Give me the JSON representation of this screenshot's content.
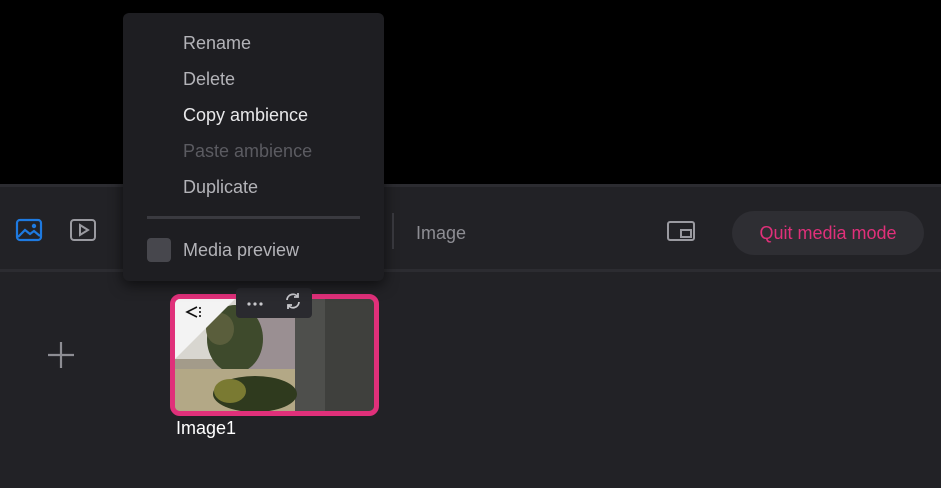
{
  "toolbar": {
    "mode_label": "Image",
    "quit_label": "Quit media mode",
    "icons": [
      "image-icon",
      "video-icon",
      "picture-in-picture-icon"
    ],
    "accent_color": "#1e7ae0",
    "quit_color": "#e0307a"
  },
  "context_menu": {
    "items": [
      {
        "label": "Rename",
        "state": "normal"
      },
      {
        "label": "Delete",
        "state": "normal"
      },
      {
        "label": "Copy ambience",
        "state": "highlighted"
      },
      {
        "label": "Paste ambience",
        "state": "disabled"
      },
      {
        "label": "Duplicate",
        "state": "normal"
      }
    ],
    "media_preview_label": "Media preview",
    "media_preview_checked": false
  },
  "media": {
    "add_icon": "plus-icon",
    "items": [
      {
        "caption": "Image1",
        "selected": true
      }
    ],
    "actions": [
      "more-icon",
      "refresh-icon"
    ]
  }
}
